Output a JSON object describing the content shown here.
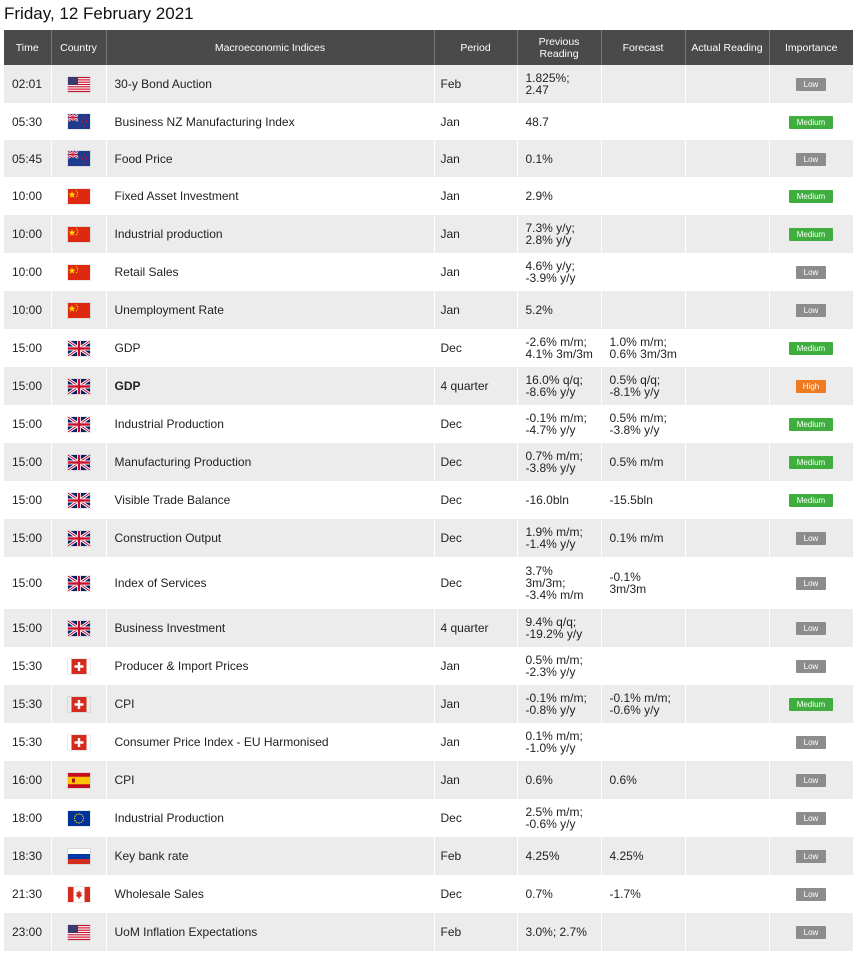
{
  "page": {
    "date_title": "Friday, 12 February 2021"
  },
  "table": {
    "headers": {
      "time": "Time",
      "country": "Country",
      "indicator": "Macroeconomic Indices",
      "period": "Period",
      "previous": "Previous\nReading",
      "forecast": "Forecast",
      "actual": "Actual Reading",
      "importance": "Importance"
    },
    "rows": [
      {
        "time": "02:01",
        "country": "us-flag-icon",
        "indicator": "30-y Bond Auction",
        "period": "Feb",
        "previous": "1.825%;\n2.47",
        "forecast": "",
        "actual": "",
        "importance": "Low"
      },
      {
        "time": "05:30",
        "country": "nz-flag-icon",
        "indicator": "Business NZ Manufacturing Index",
        "period": "Jan",
        "previous": "48.7",
        "forecast": "",
        "actual": "",
        "importance": "Medium"
      },
      {
        "time": "05:45",
        "country": "nz-flag-icon",
        "indicator": "Food Price",
        "period": "Jan",
        "previous": "0.1%",
        "forecast": "",
        "actual": "",
        "importance": "Low"
      },
      {
        "time": "10:00",
        "country": "cn-flag-icon",
        "indicator": "Fixed Asset Investment",
        "period": "Jan",
        "previous": "2.9%",
        "forecast": "",
        "actual": "",
        "importance": "Medium"
      },
      {
        "time": "10:00",
        "country": "cn-flag-icon",
        "indicator": "Industrial production",
        "period": "Jan",
        "previous": "7.3% y/y;\n2.8% y/y",
        "forecast": "",
        "actual": "",
        "importance": "Medium"
      },
      {
        "time": "10:00",
        "country": "cn-flag-icon",
        "indicator": "Retail Sales",
        "period": "Jan",
        "previous": "4.6% y/y;\n-3.9% y/y",
        "forecast": "",
        "actual": "",
        "importance": "Low"
      },
      {
        "time": "10:00",
        "country": "cn-flag-icon",
        "indicator": "Unemployment Rate",
        "period": "Jan",
        "previous": "5.2%",
        "forecast": "",
        "actual": "",
        "importance": "Low"
      },
      {
        "time": "15:00",
        "country": "uk-flag-icon",
        "indicator": "GDP",
        "period": "Dec",
        "previous": "-2.6% m/m;\n4.1% 3m/3m",
        "forecast": "1.0% m/m;\n0.6% 3m/3m",
        "actual": "",
        "importance": "Medium"
      },
      {
        "time": "15:00",
        "country": "uk-flag-icon",
        "indicator": "GDP",
        "period": "4 quarter",
        "previous": "16.0% q/q;\n-8.6% y/y",
        "forecast": "0.5% q/q;\n-8.1% y/y",
        "actual": "",
        "importance": "High",
        "bold": true
      },
      {
        "time": "15:00",
        "country": "uk-flag-icon",
        "indicator": "Industrial Production",
        "period": "Dec",
        "previous": "-0.1% m/m;\n-4.7% y/y",
        "forecast": "0.5% m/m;\n-3.8% y/y",
        "actual": "",
        "importance": "Medium"
      },
      {
        "time": "15:00",
        "country": "uk-flag-icon",
        "indicator": "Manufacturing Production",
        "period": "Dec",
        "previous": "0.7% m/m;\n-3.8% y/y",
        "forecast": "0.5% m/m",
        "actual": "",
        "importance": "Medium"
      },
      {
        "time": "15:00",
        "country": "uk-flag-icon",
        "indicator": "Visible Trade Balance",
        "period": "Dec",
        "previous": "-16.0bln",
        "forecast": "-15.5bln",
        "actual": "",
        "importance": "Medium"
      },
      {
        "time": "15:00",
        "country": "uk-flag-icon",
        "indicator": "Construction Output",
        "period": "Dec",
        "previous": "1.9% m/m;\n-1.4% y/y",
        "forecast": "0.1% m/m",
        "actual": "",
        "importance": "Low"
      },
      {
        "time": "15:00",
        "country": "uk-flag-icon",
        "indicator": "Index of Services",
        "period": "Dec",
        "previous": "3.7%\n3m/3m;\n-3.4% m/m",
        "forecast": "-0.1%\n3m/3m",
        "actual": "",
        "importance": "Low"
      },
      {
        "time": "15:00",
        "country": "uk-flag-icon",
        "indicator": "Business Investment",
        "period": "4 quarter",
        "previous": "9.4% q/q;\n-19.2% y/y",
        "forecast": "",
        "actual": "",
        "importance": "Low"
      },
      {
        "time": "15:30",
        "country": "ch-flag-icon",
        "indicator": "Producer & Import Prices",
        "period": "Jan",
        "previous": "0.5% m/m;\n-2.3% y/y",
        "forecast": "",
        "actual": "",
        "importance": "Low"
      },
      {
        "time": "15:30",
        "country": "ch-flag-icon",
        "indicator": "CPI",
        "period": "Jan",
        "previous": "-0.1% m/m;\n-0.8% y/y",
        "forecast": "-0.1% m/m;\n-0.6% y/y",
        "actual": "",
        "importance": "Medium"
      },
      {
        "time": "15:30",
        "country": "ch-flag-icon",
        "indicator": "Consumer Price Index - EU Harmonised",
        "period": "Jan",
        "previous": "0.1% m/m;\n-1.0% y/y",
        "forecast": "",
        "actual": "",
        "importance": "Low"
      },
      {
        "time": "16:00",
        "country": "es-flag-icon",
        "indicator": "CPI",
        "period": "Jan",
        "previous": "0.6%",
        "forecast": "0.6%",
        "actual": "",
        "importance": "Low"
      },
      {
        "time": "18:00",
        "country": "eu-flag-icon",
        "indicator": "Industrial Production",
        "period": "Dec",
        "previous": "2.5% m/m;\n-0.6% y/y",
        "forecast": "",
        "actual": "",
        "importance": "Low"
      },
      {
        "time": "18:30",
        "country": "ru-flag-icon",
        "indicator": "Key bank rate",
        "period": "Feb",
        "previous": "4.25%",
        "forecast": "4.25%",
        "actual": "",
        "importance": "Low"
      },
      {
        "time": "21:30",
        "country": "ca-flag-icon",
        "indicator": "Wholesale Sales",
        "period": "Dec",
        "previous": "0.7%",
        "forecast": "-1.7%",
        "actual": "",
        "importance": "Low"
      },
      {
        "time": "23:00",
        "country": "us-flag-icon",
        "indicator": "UoM Inflation Expectations",
        "period": "Feb",
        "previous": "3.0%; 2.7%",
        "forecast": "",
        "actual": "",
        "importance": "Low"
      }
    ]
  },
  "colors": {
    "header_bg": "#4a4a4a",
    "row_alt": "#ececec",
    "low": "#8c8c8c",
    "medium": "#3fae3f",
    "high": "#ee7a22"
  }
}
